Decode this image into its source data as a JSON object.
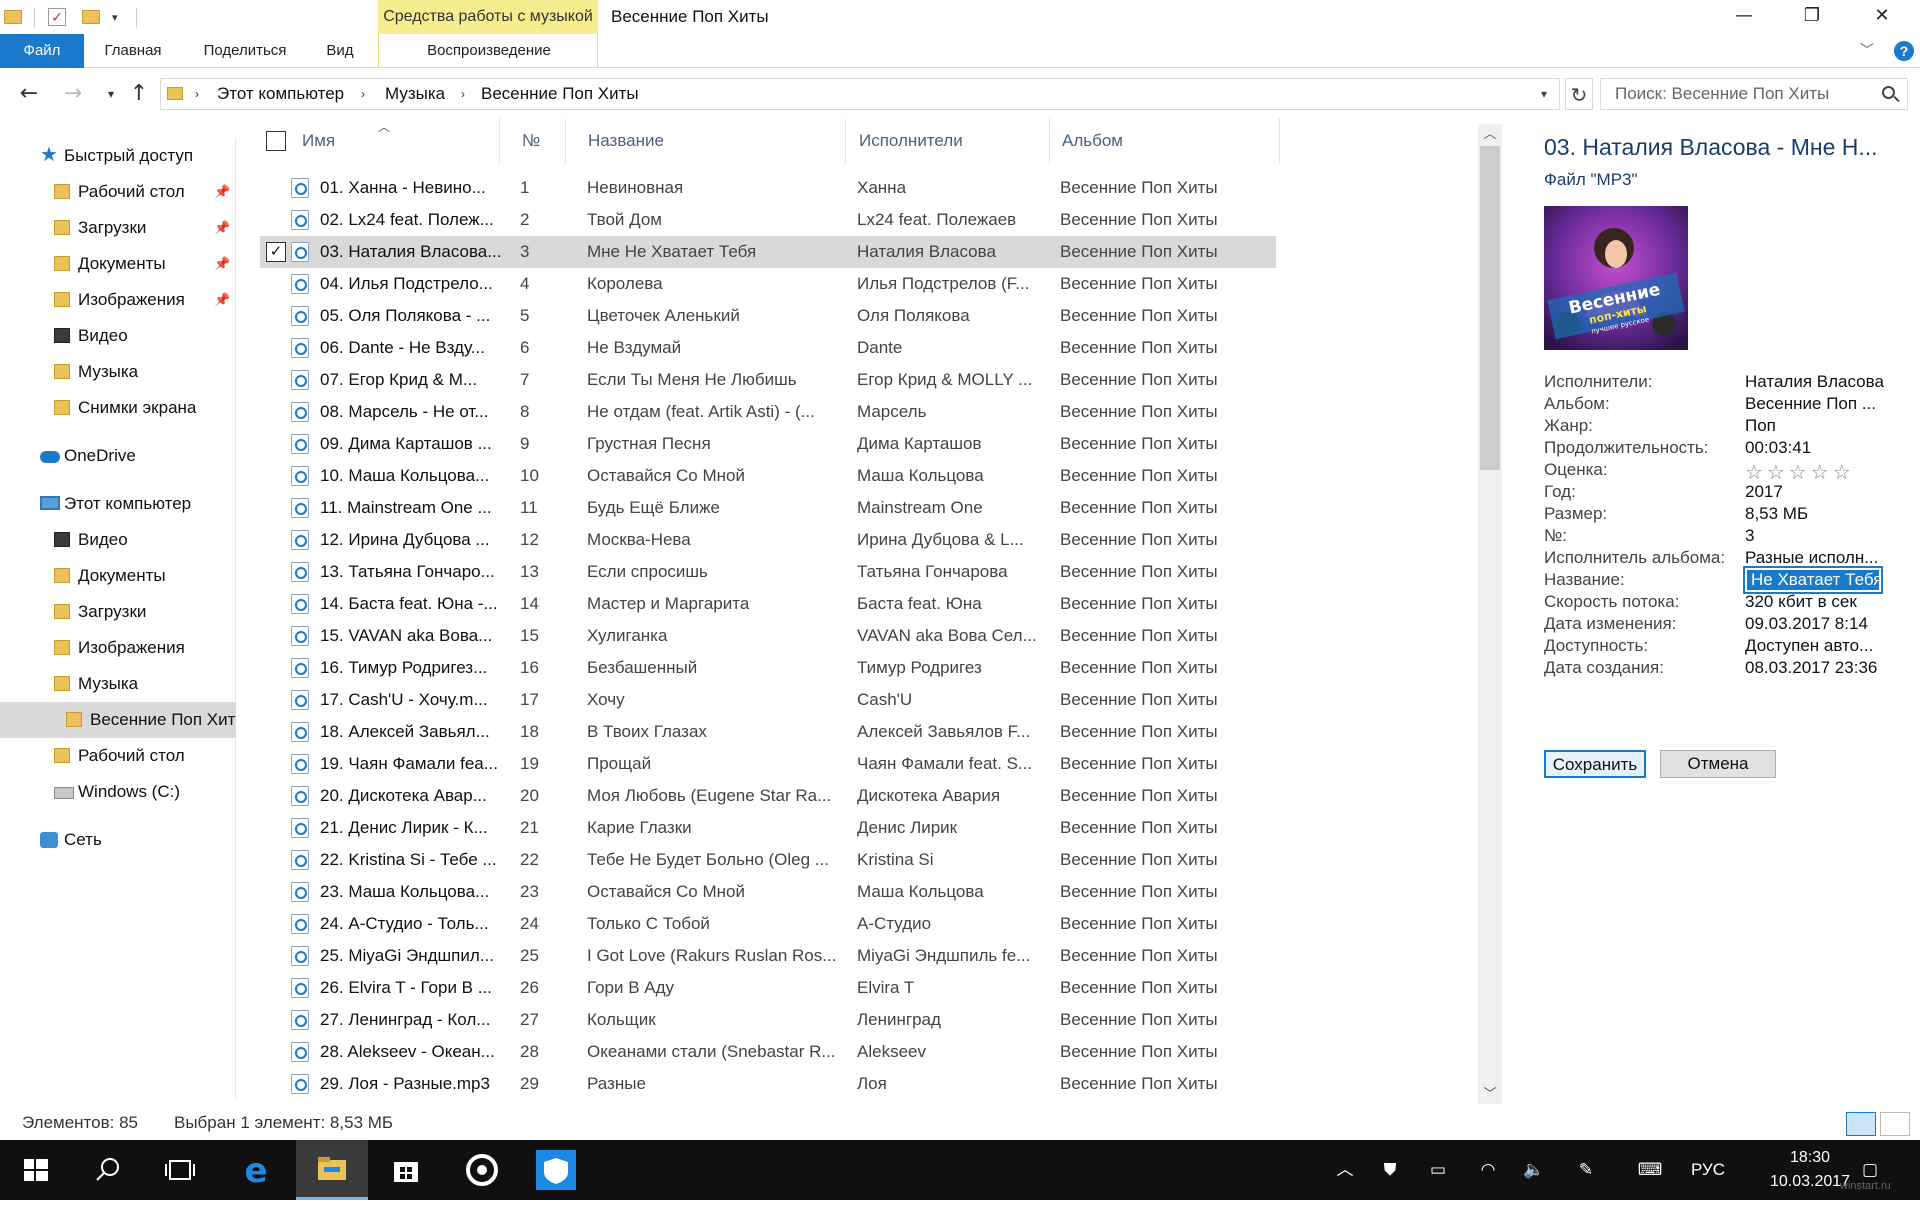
{
  "window": {
    "context_tab": "Средства работы с музыкой",
    "title": "Весенние Поп Хиты",
    "minimize": "—",
    "restore": "❐",
    "close": "✕"
  },
  "ribbon": {
    "tabs": [
      "Файл",
      "Главная",
      "Поделиться",
      "Вид"
    ],
    "context_tab": "Воспроизведение",
    "help": "?"
  },
  "address": {
    "crumbs": [
      "Этот компьютер",
      "Музыка",
      "Весенние Поп Хиты"
    ],
    "search_placeholder": "Поиск: Весенние Поп Хиты"
  },
  "nav": {
    "items": [
      {
        "label": "Быстрый доступ",
        "icon": "star-icon",
        "pinned": false
      },
      {
        "label": "Рабочий стол",
        "icon": "desktop-folder-icon",
        "pinned": true
      },
      {
        "label": "Загрузки",
        "icon": "downloads-folder-icon",
        "pinned": true
      },
      {
        "label": "Документы",
        "icon": "documents-folder-icon",
        "pinned": true
      },
      {
        "label": "Изображения",
        "icon": "pictures-folder-icon",
        "pinned": true
      },
      {
        "label": "Видео",
        "icon": "videos-folder-icon",
        "pinned": false
      },
      {
        "label": "Музыка",
        "icon": "music-folder-icon",
        "pinned": false
      },
      {
        "label": "Снимки экрана",
        "icon": "folder-icon",
        "pinned": false
      },
      {
        "label": "OneDrive",
        "icon": "cloud-icon",
        "pinned": false
      },
      {
        "label": "Этот компьютер",
        "icon": "computer-icon",
        "pinned": false
      },
      {
        "label": "Видео",
        "icon": "videos-folder-icon",
        "pinned": false
      },
      {
        "label": "Документы",
        "icon": "documents-folder-icon",
        "pinned": false
      },
      {
        "label": "Загрузки",
        "icon": "downloads-folder-icon",
        "pinned": false
      },
      {
        "label": "Изображения",
        "icon": "pictures-folder-icon",
        "pinned": false
      },
      {
        "label": "Музыка",
        "icon": "music-folder-icon",
        "pinned": false
      },
      {
        "label": "Весенние Поп Хиты",
        "icon": "folder-icon",
        "pinned": false,
        "selected": true
      },
      {
        "label": "Рабочий стол",
        "icon": "desktop-folder-icon",
        "pinned": false
      },
      {
        "label": "Windows (C:)",
        "icon": "drive-icon",
        "pinned": false
      },
      {
        "label": "Сеть",
        "icon": "network-icon",
        "pinned": false
      }
    ]
  },
  "columns": [
    "Имя",
    "№",
    "Название",
    "Исполнители",
    "Альбом"
  ],
  "files": [
    {
      "name": "01. Ханна - Невино...",
      "num": "1",
      "title": "Невиновная",
      "artist": "Ханна",
      "album": "Весенние Поп Хиты"
    },
    {
      "name": "02. Lx24 feat. Полеж...",
      "num": "2",
      "title": "Твой Дом",
      "artist": "Lx24 feat. Полежаев",
      "album": "Весенние Поп Хиты"
    },
    {
      "name": "03. Наталия Власова...",
      "num": "3",
      "title": "Мне Не Хватает Тебя",
      "artist": "Наталия Власова",
      "album": "Весенние Поп Хиты",
      "selected": true
    },
    {
      "name": "04. Илья Подстрело...",
      "num": "4",
      "title": "Королева",
      "artist": "Илья Подстрелов (F...",
      "album": "Весенние Поп Хиты"
    },
    {
      "name": "05. Оля Полякова - ...",
      "num": "5",
      "title": "Цветочек Аленький",
      "artist": "Оля Полякова",
      "album": "Весенние Поп Хиты"
    },
    {
      "name": "06. Dante - Не Взду...",
      "num": "6",
      "title": "Не Вздумай",
      "artist": "Dante",
      "album": "Весенние Поп Хиты"
    },
    {
      "name": "07. Егор Крид & M...",
      "num": "7",
      "title": "Если Ты Меня Не Любишь",
      "artist": "Егор Крид & MOLLY ...",
      "album": "Весенние Поп Хиты"
    },
    {
      "name": "08. Марсель - Не от...",
      "num": "8",
      "title": "Не отдам (feat. Artik Asti) - (...",
      "artist": "Марсель",
      "album": "Весенние Поп Хиты"
    },
    {
      "name": "09. Дима Карташов ...",
      "num": "9",
      "title": "Грустная Песня",
      "artist": "Дима Карташов",
      "album": "Весенние Поп Хиты"
    },
    {
      "name": "10. Маша Кольцова...",
      "num": "10",
      "title": "Оставайся Со Мной",
      "artist": "Маша Кольцова",
      "album": "Весенние Поп Хиты"
    },
    {
      "name": "11. Mainstream One ...",
      "num": "11",
      "title": "Будь Ещё Ближе",
      "artist": "Mainstream One",
      "album": "Весенние Поп Хиты"
    },
    {
      "name": "12. Ирина Дубцова ...",
      "num": "12",
      "title": "Москва-Нева",
      "artist": "Ирина Дубцова & L...",
      "album": "Весенние Поп Хиты"
    },
    {
      "name": "13. Татьяна Гончаро...",
      "num": "13",
      "title": "Если спросишь",
      "artist": "Татьяна Гончарова",
      "album": "Весенние Поп Хиты"
    },
    {
      "name": "14. Баста feat. Юна -...",
      "num": "14",
      "title": "Мастер и Маргарита",
      "artist": "Баста feat. Юна",
      "album": "Весенние Поп Хиты"
    },
    {
      "name": "15. VAVAN aka Вова...",
      "num": "15",
      "title": "Хулиганка",
      "artist": "VAVAN aka Вова Сел...",
      "album": "Весенние Поп Хиты"
    },
    {
      "name": "16. Тимур Родригез...",
      "num": "16",
      "title": "Безбашенный",
      "artist": "Тимур Родригез",
      "album": "Весенние Поп Хиты"
    },
    {
      "name": "17. Cash'U - Хочу.m...",
      "num": "17",
      "title": "Хочу",
      "artist": "Cash'U",
      "album": "Весенние Поп Хиты"
    },
    {
      "name": "18. Алексей Завьял...",
      "num": "18",
      "title": "В Твоих Глазах",
      "artist": "Алексей Завьялов F...",
      "album": "Весенние Поп Хиты"
    },
    {
      "name": "19. Чаян Фамали fea...",
      "num": "19",
      "title": "Прощай",
      "artist": "Чаян Фамали feat. S...",
      "album": "Весенние Поп Хиты"
    },
    {
      "name": "20. Дискотека Авар...",
      "num": "20",
      "title": "Моя Любовь (Eugene Star Ra...",
      "artist": "Дискотека Авария",
      "album": "Весенние Поп Хиты"
    },
    {
      "name": "21. Денис Лирик - К...",
      "num": "21",
      "title": "Карие Глазки",
      "artist": "Денис Лирик",
      "album": "Весенние Поп Хиты"
    },
    {
      "name": "22. Kristina Si - Тебе ...",
      "num": "22",
      "title": "Тебе Не Будет Больно (Oleg ...",
      "artist": "Kristina Si",
      "album": "Весенние Поп Хиты"
    },
    {
      "name": "23. Маша Кольцова...",
      "num": "23",
      "title": "Оставайся Со Мной",
      "artist": "Маша Кольцова",
      "album": "Весенние Поп Хиты"
    },
    {
      "name": "24. А-Студио - Толь...",
      "num": "24",
      "title": "Только С Тобой",
      "artist": "А-Студио",
      "album": "Весенние Поп Хиты"
    },
    {
      "name": "25. MiyaGi Эндшпил...",
      "num": "25",
      "title": "I Got Love (Rakurs Ruslan Ros...",
      "artist": "MiyaGi Эндшпиль fe...",
      "album": "Весенние Поп Хиты"
    },
    {
      "name": "26. Elvira T - Гори В ...",
      "num": "26",
      "title": "Гори В Аду",
      "artist": "Elvira T",
      "album": "Весенние Поп Хиты"
    },
    {
      "name": "27. Ленинград - Кол...",
      "num": "27",
      "title": "Кольщик",
      "artist": "Ленинград",
      "album": "Весенние Поп Хиты"
    },
    {
      "name": "28. Alekseev - Океан...",
      "num": "28",
      "title": "Океанами стали (Snebastar R...",
      "artist": "Alekseev",
      "album": "Весенние Поп Хиты"
    },
    {
      "name": "29. Лоя - Разные.mp3",
      "num": "29",
      "title": "Разные",
      "artist": "Лоя",
      "album": "Весенние Поп Хиты"
    }
  ],
  "details": {
    "title": "03. Наталия Власова - Мне Н...",
    "type": "Файл \"MP3\"",
    "cover_text": [
      "Весенние",
      "поп-хиты",
      "лучшее русское"
    ],
    "props": [
      {
        "label": "Исполнители:",
        "value": "Наталия Власова"
      },
      {
        "label": "Альбом:",
        "value": "Весенние Поп ..."
      },
      {
        "label": "Жанр:",
        "value": "Поп"
      },
      {
        "label": "Продолжительность:",
        "value": "00:03:41"
      },
      {
        "label": "Оценка:",
        "value": "☆☆☆☆☆"
      },
      {
        "label": "Год:",
        "value": "2017"
      },
      {
        "label": "Размер:",
        "value": "8,53 МБ"
      },
      {
        "label": "№:",
        "value": "3"
      },
      {
        "label": "Исполнитель альбома:",
        "value": "Разные исполн..."
      },
      {
        "label": "Название:",
        "value": "Не Хватает Тебя",
        "editing": true
      },
      {
        "label": "Скорость потока:",
        "value": "320 кбит в сек"
      },
      {
        "label": "Дата изменения:",
        "value": "09.03.2017 8:14"
      },
      {
        "label": "Доступность:",
        "value": "Доступен авто..."
      },
      {
        "label": "Дата создания:",
        "value": "08.03.2017 23:36"
      }
    ],
    "save": "Сохранить",
    "cancel": "Отмена"
  },
  "status": {
    "count": "Элементов: 85",
    "selection": "Выбран 1 элемент: 8,53 МБ"
  },
  "taskbar": {
    "language": "РУС",
    "time": "18:30",
    "date": "10.03.2017"
  },
  "watermark": "winstart.ru",
  "colors": {
    "accent": "#1979ca",
    "context_tab": "#f5ee8e",
    "selection": "#d9d9d9",
    "header_text": "#4d6082",
    "taskbar": "#101010"
  }
}
